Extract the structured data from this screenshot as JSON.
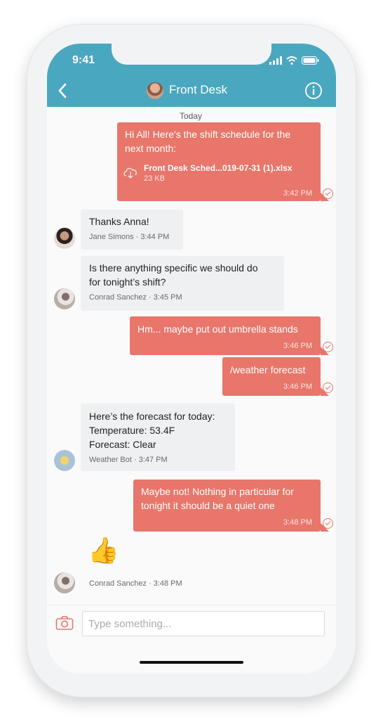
{
  "status_bar": {
    "time": "9:41"
  },
  "header": {
    "title": "Front Desk"
  },
  "chat": {
    "date_separator": "Today",
    "messages": [
      {
        "text_line1": "Hi All! Here's the shift schedule for the",
        "text_line2": "next month:",
        "attachment_name": "Front Desk Sched...019-07-31 (1).xlsx",
        "attachment_size": "23 KB",
        "time": "3:42 PM"
      },
      {
        "text": "Thanks Anna!",
        "meta": "Jane Simons · 3:44 PM"
      },
      {
        "text_line1": "Is there anything specific we should do",
        "text_line2": "for tonight’s shift?",
        "meta": "Conrad Sanchez · 3:45 PM"
      },
      {
        "text": "Hm... maybe put out umbrella stands",
        "time": "3:46 PM"
      },
      {
        "text": "/weather forecast",
        "time": "3:46 PM"
      },
      {
        "line1": "Here’s the forecast for today:",
        "line2": "Temperature: 53.4F",
        "line3": "Forecast: Clear",
        "meta": "Weather Bot · 3:47 PM"
      },
      {
        "text_line1": "Maybe not! Nothing in particular for",
        "text_line2": "tonight it should be a quiet one",
        "time": "3:48 PM"
      },
      {
        "emoji": "👍",
        "meta": "Conrad Sanchez · 3:48 PM"
      }
    ]
  },
  "composer": {
    "placeholder": "Type something..."
  },
  "icons": {
    "back": "back-chevron-icon",
    "info": "info-icon",
    "camera": "camera-icon",
    "download": "download-cloud-icon",
    "read_receipt": "check-circle-icon"
  },
  "colors": {
    "header": "#4aa7c0",
    "outgoing_bubble": "#e8766b",
    "incoming_bubble": "#eff0f2"
  }
}
